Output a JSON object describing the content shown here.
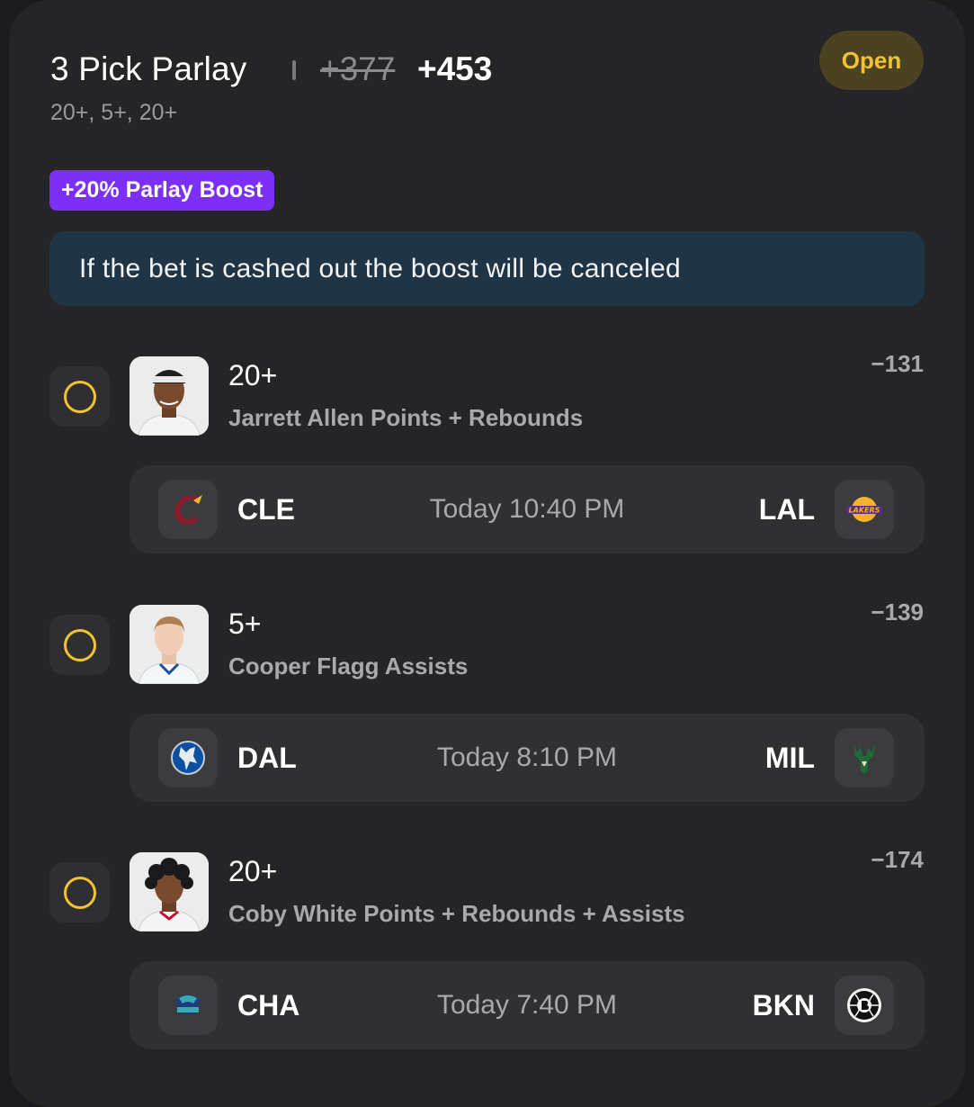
{
  "header": {
    "title": "3 Pick Parlay",
    "old_odds": "+377",
    "new_odds": "+453",
    "subtitle": "20+, 5+, 20+",
    "status": "Open"
  },
  "boost": {
    "label": "+20% Parlay Boost",
    "notice": "If the bet is cashed out the boost will be canceled"
  },
  "colors": {
    "accent_yellow": "#f2c230",
    "boost_purple": "#7b2ff7",
    "notice_bg": "#1f3545",
    "card_bg": "#252527"
  },
  "legs": [
    {
      "line": "20+",
      "description": "Jarrett Allen Points + Rebounds",
      "odds": "−131",
      "away": {
        "abbr": "CLE",
        "logo": "cavaliers-logo-icon"
      },
      "home": {
        "abbr": "LAL",
        "logo": "lakers-logo-icon"
      },
      "time": "Today 10:40 PM"
    },
    {
      "line": "5+",
      "description": "Cooper Flagg Assists",
      "odds": "−139",
      "away": {
        "abbr": "DAL",
        "logo": "mavericks-logo-icon"
      },
      "home": {
        "abbr": "MIL",
        "logo": "bucks-logo-icon"
      },
      "time": "Today 8:10 PM"
    },
    {
      "line": "20+",
      "description": "Coby White Points + Rebounds + Assists",
      "odds": "−174",
      "away": {
        "abbr": "CHA",
        "logo": "hornets-logo-icon"
      },
      "home": {
        "abbr": "BKN",
        "logo": "nets-logo-icon"
      },
      "time": "Today 7:40 PM"
    }
  ]
}
